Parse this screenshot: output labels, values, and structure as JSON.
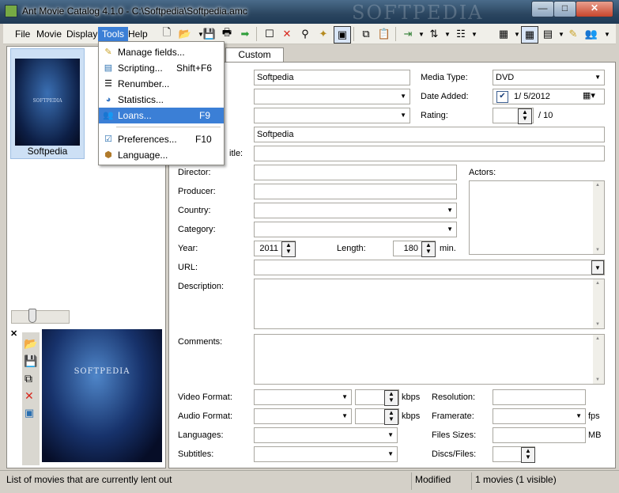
{
  "window": {
    "title": "Ant Movie Catalog 4.1.0 - C:\\Softpedia\\Softpedia.amc",
    "watermark": "SOFTPEDIA",
    "buttons": {
      "minimize": "—",
      "maximize": "□",
      "close": "✕"
    }
  },
  "menubar": {
    "file": "File",
    "movie": "Movie",
    "display": "Display",
    "tools": "Tools",
    "help": "Help"
  },
  "tools_menu": {
    "items": [
      {
        "label": "Manage fields...",
        "shortcut": "",
        "icon": "pencil-icon"
      },
      {
        "label": "Scripting...",
        "shortcut": "Shift+F6",
        "icon": "script-icon"
      },
      {
        "label": "Renumber...",
        "shortcut": "",
        "icon": "list-icon"
      },
      {
        "label": "Statistics...",
        "shortcut": "",
        "icon": "pie-chart-icon"
      },
      {
        "label": "Loans...",
        "shortcut": "F9",
        "icon": "people-icon"
      },
      {
        "label": "Preferences...",
        "shortcut": "F10",
        "icon": "preferences-icon"
      },
      {
        "label": "Language...",
        "shortcut": "",
        "icon": "language-icon"
      }
    ],
    "highlighted": "Loans..."
  },
  "movie_list": {
    "items": [
      {
        "label": "Softpedia",
        "thumb_text": "SOFTPEDIA"
      }
    ]
  },
  "poster": {
    "text": "SOFTPEDIA"
  },
  "tabs": {
    "custom_fields": "Custom Fields"
  },
  "form": {
    "field1": "Softpedia",
    "media_type_label": "Media Type:",
    "media_type": "DVD",
    "date_added_label": "Date Added:",
    "date_added": "1/  5/2012",
    "rating_label": "Rating:",
    "rating_max": "/ 10",
    "original_title_value": "Softpedia",
    "translated_title_label_partial": "itle:",
    "director_label": "Director:",
    "producer_label": "Producer:",
    "country_label": "Country:",
    "category_label": "Category:",
    "year_label": "Year:",
    "year": "2011",
    "length_label": "Length:",
    "length": "180",
    "length_unit": "min.",
    "actors_label": "Actors:",
    "url_label": "URL:",
    "description_label": "Description:",
    "comments_label": "Comments:",
    "video_format_label": "Video Format:",
    "audio_format_label": "Audio Format:",
    "kbps": "kbps",
    "resolution_label": "Resolution:",
    "framerate_label": "Framerate:",
    "fps": "fps",
    "languages_label": "Languages:",
    "files_sizes_label": "Files Sizes:",
    "mb": "MB",
    "subtitles_label": "Subtitles:",
    "discs_files_label": "Discs/Files:"
  },
  "statusbar": {
    "hint": "List of movies that are currently lent out",
    "state": "Modified",
    "count": "1 movies (1 visible)"
  }
}
